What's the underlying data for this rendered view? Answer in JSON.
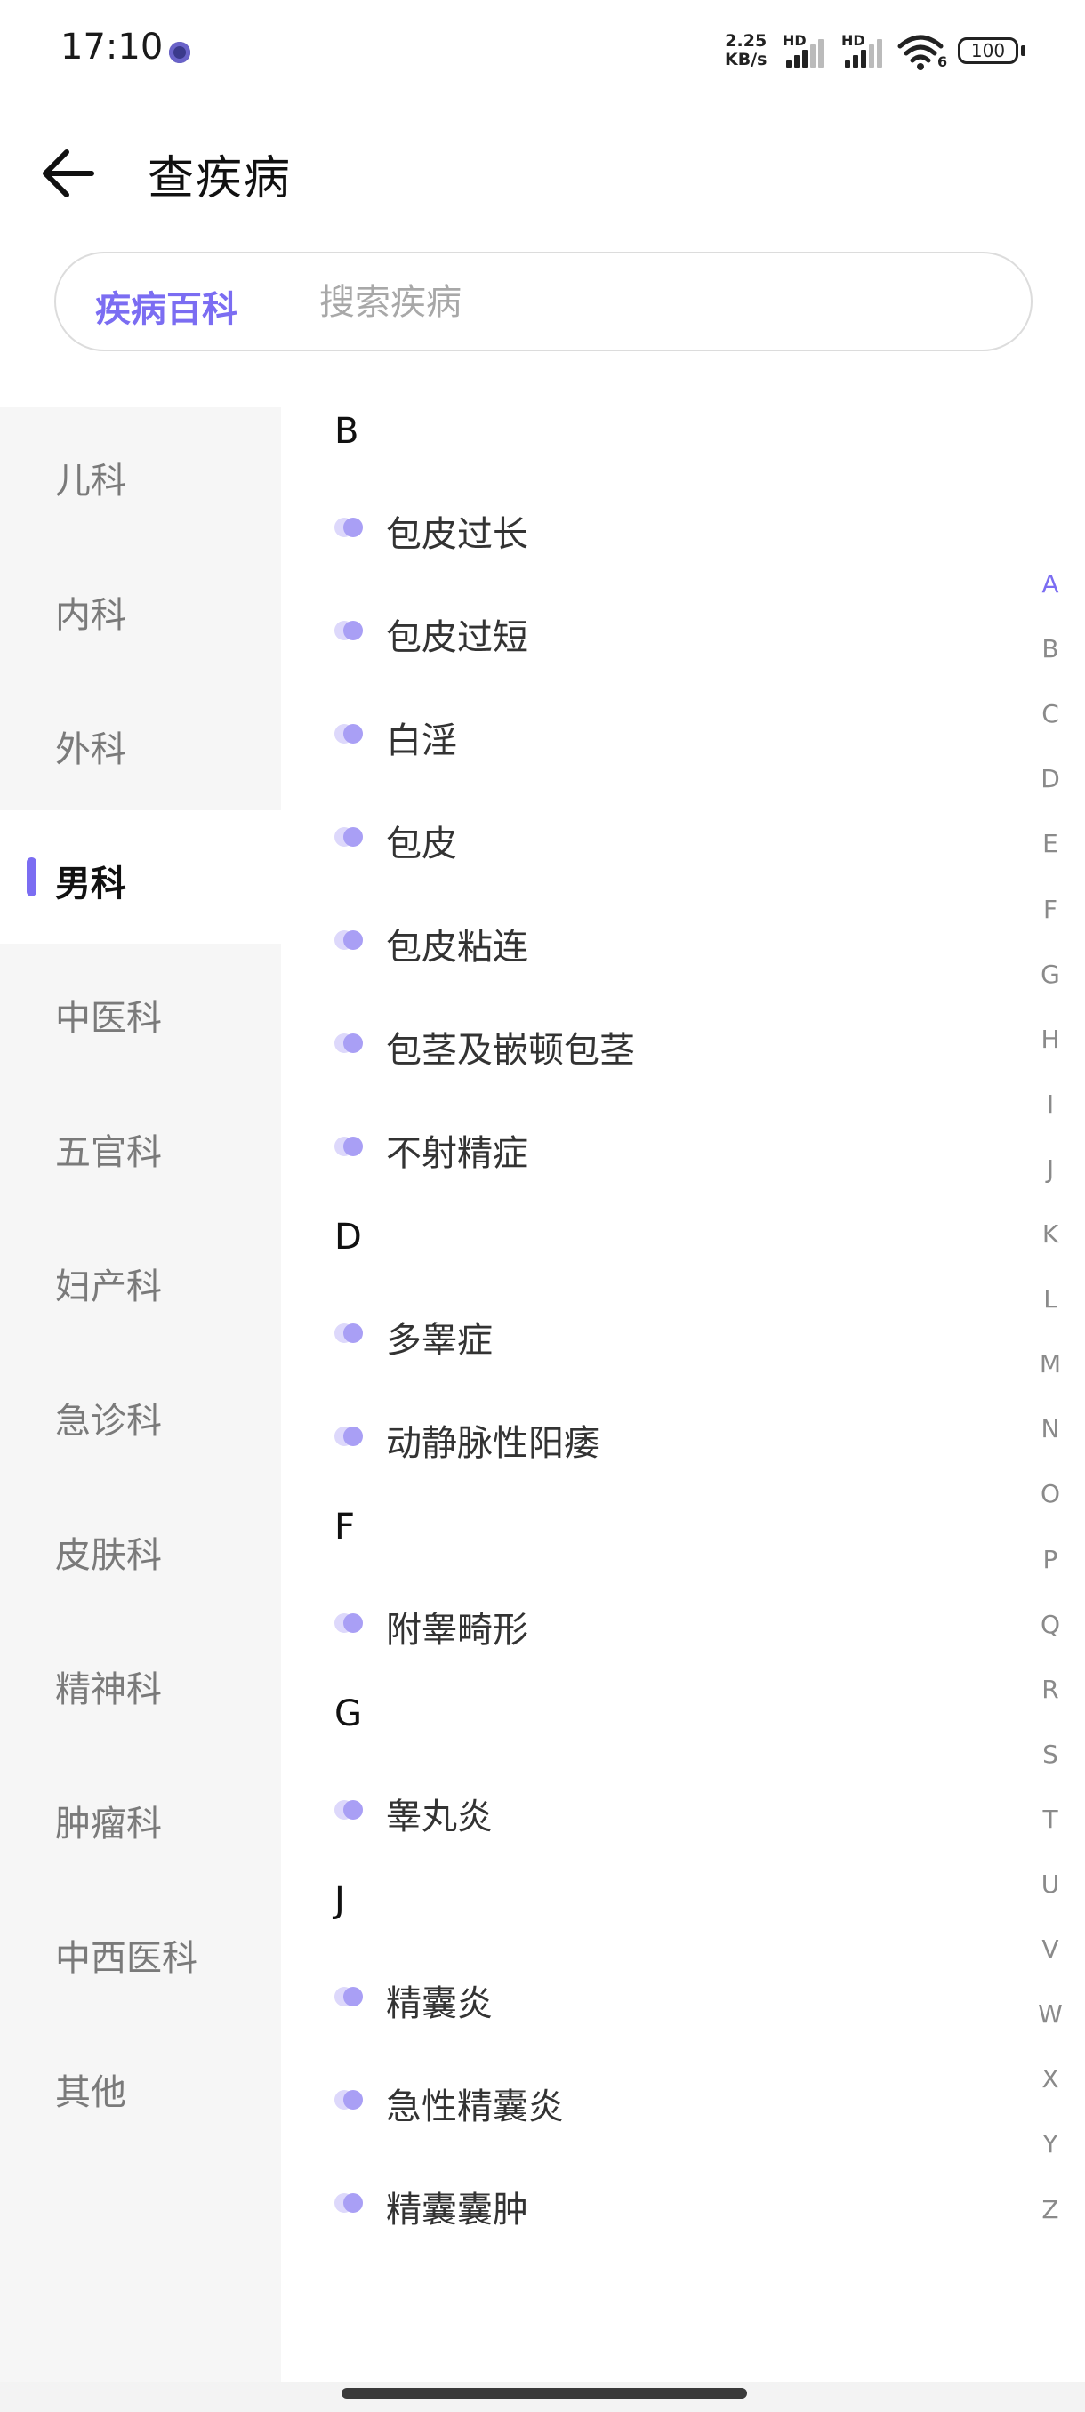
{
  "status_bar": {
    "time": "17:10",
    "net_speed_value": "2.25",
    "net_speed_unit": "KB/s",
    "sim1_label": "HD",
    "sim2_label": "HD",
    "wifi_label": "6",
    "battery": "100"
  },
  "header": {
    "title": "查疾病",
    "back_icon": "arrow-left-icon"
  },
  "search": {
    "tab_label": "疾病百科",
    "placeholder": "搜索疾病",
    "value": ""
  },
  "sidebar": {
    "active_index": 3,
    "items": [
      {
        "label": "儿科"
      },
      {
        "label": "内科"
      },
      {
        "label": "外科"
      },
      {
        "label": "男科"
      },
      {
        "label": "中医科"
      },
      {
        "label": "五官科"
      },
      {
        "label": "妇产科"
      },
      {
        "label": "急诊科"
      },
      {
        "label": "皮肤科"
      },
      {
        "label": "精神科"
      },
      {
        "label": "肿瘤科"
      },
      {
        "label": "中西医科"
      },
      {
        "label": "其他"
      }
    ]
  },
  "sections": [
    {
      "letter": "B",
      "items": [
        "包皮过长",
        "包皮过短",
        "白淫",
        "包皮",
        "包皮粘连",
        "包茎及嵌顿包茎",
        "不射精症"
      ]
    },
    {
      "letter": "D",
      "items": [
        "多睾症",
        "动静脉性阳痿"
      ]
    },
    {
      "letter": "F",
      "items": [
        "附睾畸形"
      ]
    },
    {
      "letter": "G",
      "items": [
        "睾丸炎"
      ]
    },
    {
      "letter": "J",
      "items": [
        "精囊炎",
        "急性精囊炎",
        "精囊囊肿"
      ]
    }
  ],
  "alphabet": {
    "active": "A",
    "letters": [
      "A",
      "B",
      "C",
      "D",
      "E",
      "F",
      "G",
      "H",
      "I",
      "J",
      "K",
      "L",
      "M",
      "N",
      "O",
      "P",
      "Q",
      "R",
      "S",
      "T",
      "U",
      "V",
      "W",
      "X",
      "Y",
      "Z"
    ]
  },
  "colors": {
    "accent": "#7b6df2",
    "bullet_light": "#ddd8fb",
    "bullet_dark": "#a99ff5",
    "sidebar_bg": "#f6f6f6"
  }
}
